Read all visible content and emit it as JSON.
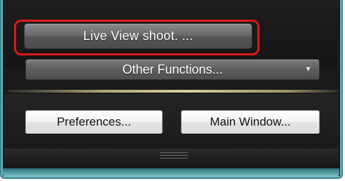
{
  "panel": {
    "live_view_button": "Live View shoot. ...",
    "other_functions": {
      "label": "Other Functions...",
      "arrow": "▼"
    },
    "preferences_button": "Preferences...",
    "main_window_button": "Main Window..."
  },
  "colors": {
    "highlight": "#e01818",
    "frame_accent": "#3f8a93"
  }
}
